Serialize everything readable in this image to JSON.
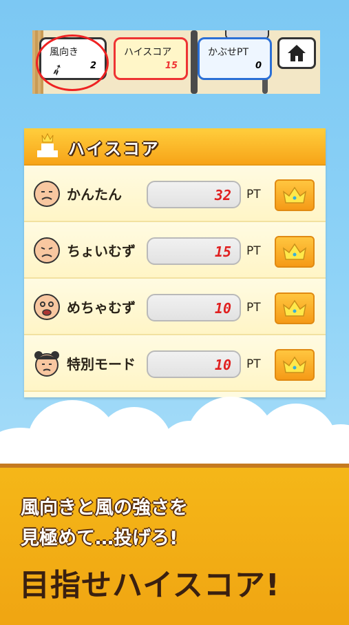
{
  "hud": {
    "wind_label": "風向き",
    "wind_value": "2",
    "highscore_label": "ハイスコア",
    "highscore_value": "15",
    "kabuse_label": "かぶせPT",
    "kabuse_value": "0",
    "home_icon": "home-icon"
  },
  "panel": {
    "title": "ハイスコア",
    "rows": [
      {
        "label": "かんたん",
        "score": "32",
        "unit": "PT"
      },
      {
        "label": "ちょいむず",
        "score": "15",
        "unit": "PT"
      },
      {
        "label": "めちゃむず",
        "score": "10",
        "unit": "PT"
      },
      {
        "label": "特別モード",
        "score": "10",
        "unit": "PT"
      }
    ]
  },
  "banner": {
    "line1": "風向きと風の強さを",
    "line2": "見極めて…投げろ!",
    "headline": "目指せハイスコア!"
  },
  "colors": {
    "sky": "#86cdf5",
    "accent_orange": "#f5a418",
    "score_red": "#e02020",
    "banner_yellow": "#f5b718"
  }
}
